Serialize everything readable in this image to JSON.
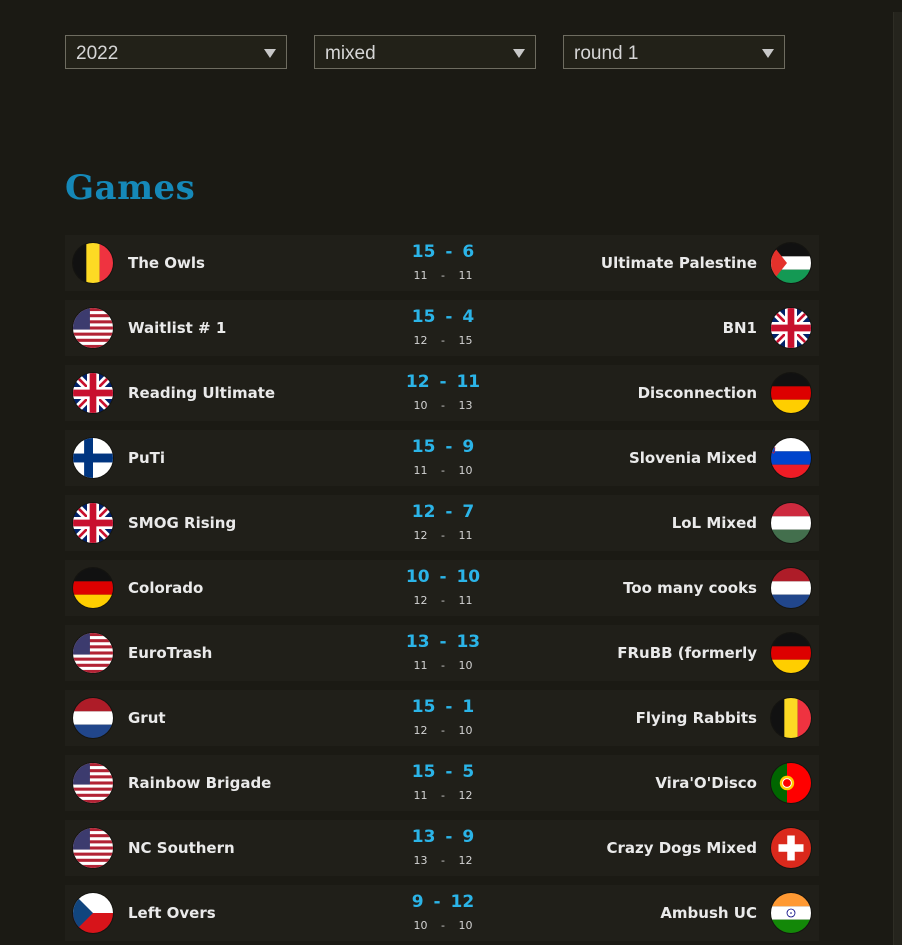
{
  "filters": {
    "year": "2022",
    "division": "mixed",
    "round": "round 1"
  },
  "section_title": "Games",
  "games": [
    {
      "home": "The Owls",
      "home_flag": "belgium-flag",
      "away": "Ultimate Palestine",
      "away_flag": "palestine-flag",
      "score": "15 - 6",
      "seeds": "11 - 11"
    },
    {
      "home": "Waitlist # 1",
      "home_flag": "usa-flag",
      "away": "BN1",
      "away_flag": "uk-flag",
      "score": "15 - 4",
      "seeds": "12 - 15"
    },
    {
      "home": "Reading Ultimate",
      "home_flag": "uk-flag",
      "away": "Disconnection",
      "away_flag": "germany-flag",
      "score": "12 - 11",
      "seeds": "10 - 13"
    },
    {
      "home": "PuTi",
      "home_flag": "finland-flag",
      "away": "Slovenia Mixed",
      "away_flag": "slovenia-flag",
      "score": "15 - 9",
      "seeds": "11 - 10"
    },
    {
      "home": "SMOG Rising",
      "home_flag": "uk-flag",
      "away": "LoL Mixed",
      "away_flag": "hungary-flag",
      "score": "12 - 7",
      "seeds": "12 - 11"
    },
    {
      "home": "Colorado",
      "home_flag": "germany-flag",
      "away": "Too many cooks",
      "away_flag": "netherlands-flag",
      "score": "10 - 10",
      "seeds": "12 - 11"
    },
    {
      "home": "EuroTrash",
      "home_flag": "usa-flag",
      "away": "FRuBB (formerly",
      "away_flag": "germany-flag",
      "score": "13 - 13",
      "seeds": "11 - 10"
    },
    {
      "home": "Grut",
      "home_flag": "netherlands-flag",
      "away": "Flying Rabbits",
      "away_flag": "belgium-flag",
      "score": "15 - 1",
      "seeds": "12 - 10"
    },
    {
      "home": "Rainbow Brigade",
      "home_flag": "usa-flag",
      "away": "Vira'O'Disco",
      "away_flag": "portugal-flag",
      "score": "15 - 5",
      "seeds": "11 - 12"
    },
    {
      "home": "NC Southern",
      "home_flag": "usa-flag",
      "away": "Crazy Dogs Mixed",
      "away_flag": "switzerland-flag",
      "score": "13 - 9",
      "seeds": "13 - 12"
    },
    {
      "home": "Left Overs",
      "home_flag": "czech-flag",
      "away": "Ambush UC",
      "away_flag": "india-flag",
      "score": "9 - 12",
      "seeds": "10 - 10"
    }
  ]
}
